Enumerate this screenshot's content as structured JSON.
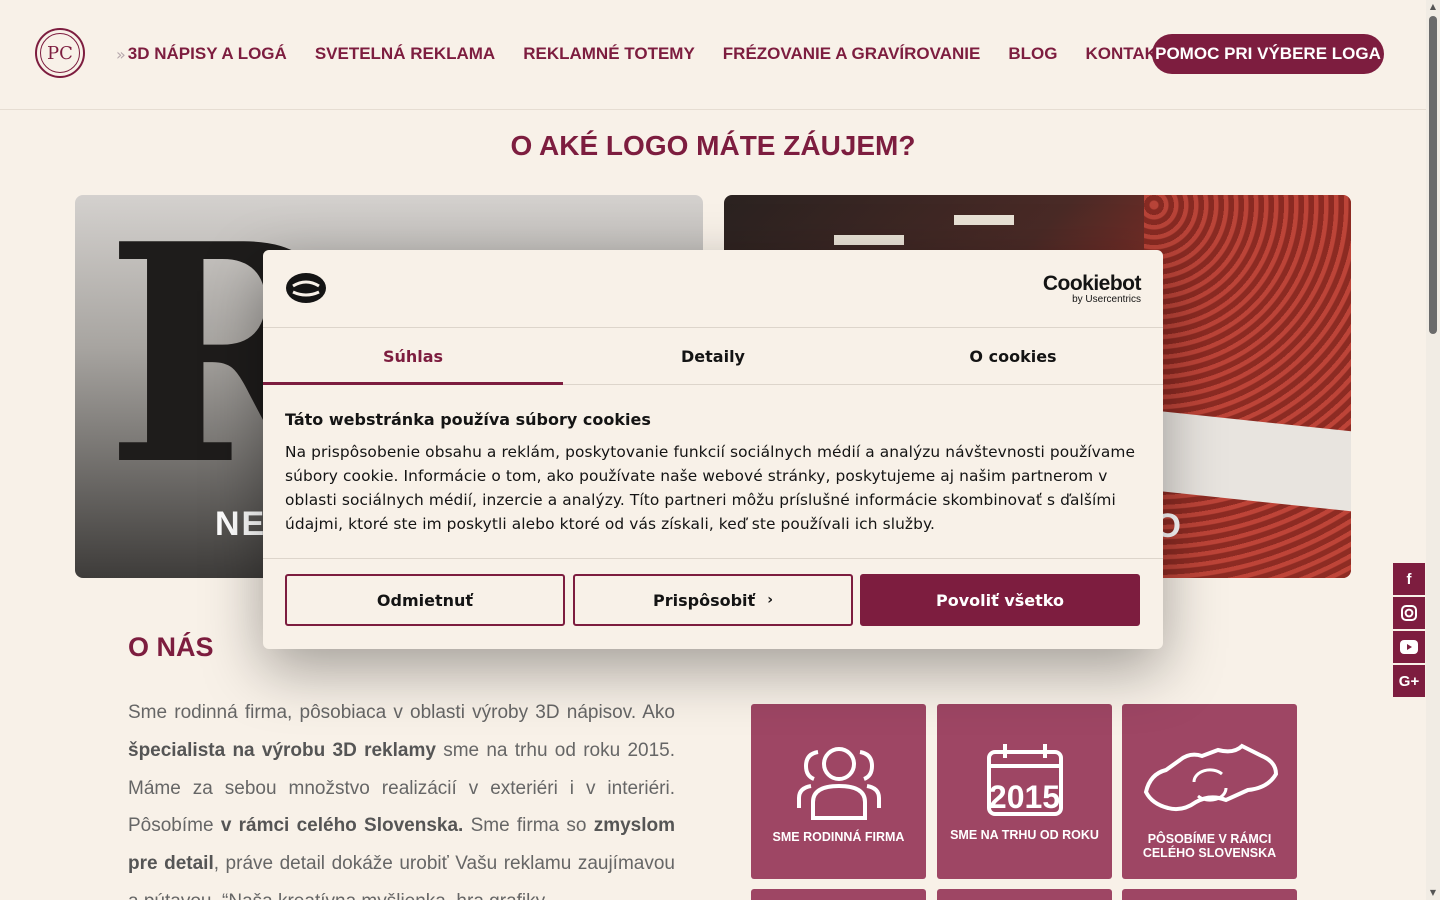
{
  "brand": {
    "logo_text": "PC"
  },
  "nav": {
    "items": [
      "3D NÁPISY A LOGÁ",
      "SVETELNÁ REKLAMA",
      "REKLAMNÉ TOTEMY",
      "FRÉZOVANIE A GRAVÍROVANIE",
      "BLOG",
      "KONTAKT"
    ],
    "cta": "POMOC PRI VÝBERE LOGA"
  },
  "hero": {
    "headline": "O AKÉ LOGO MÁTE ZÁUJEM?",
    "card_left_caption": "NE",
    "card_right_caption": "O"
  },
  "about": {
    "title": "O NÁS",
    "text_html_parts": [
      "Sme rodinná firma, pôsobiaca v oblasti výroby 3D nápisov. Ako ",
      "špecialista na výrobu 3D reklamy",
      " sme na trhu od roku 2015. Máme za sebou množstvo realizácií v exteriéri i v interiéri. Pôsobíme ",
      "v rámci celého Slovenska.",
      " Sme firma so ",
      "zmyslom pre detail",
      ", práve detail dokáže urobiť Vašu reklamu zaujímavou a pútavou. “Naša kreatívna myšlienka, hra grafiky,"
    ]
  },
  "tiles": [
    {
      "label": "SME RODINNÁ FIRMA",
      "icon": "family-icon"
    },
    {
      "label": "SME NA TRHU OD ROKU",
      "icon": "calendar-icon",
      "year": "2015"
    },
    {
      "label": "PÔSOBÍME V RÁMCI CELÉHO SLOVENSKA",
      "icon": "slovakia-map-icon"
    }
  ],
  "social": [
    "f",
    "ig",
    "yt",
    "G+"
  ],
  "cookie": {
    "brand_main": "Cookiebot",
    "brand_sub": "by Usercentrics",
    "tabs": [
      "Súhlas",
      "Detaily",
      "O cookies"
    ],
    "heading": "Táto webstránka používa súbory cookies",
    "body": "Na prispôsobenie obsahu a reklám, poskytovanie funkcií sociálnych médií a analýzu návštevnosti používame súbory cookie. Informácie o tom, ako používate naše webové stránky, poskytujeme aj našim partnerom v oblasti sociálnych médií, inzercie a analýzy. Títo partneri môžu príslušné informácie skombinovať s ďalšími údajmi, ktoré ste im poskytli alebo ktoré od vás získali, keď ste používali ich služby.",
    "btn_reject": "Odmietnuť",
    "btn_customize": "Prispôsobiť",
    "btn_accept": "Povoliť všetko"
  },
  "colors": {
    "accent": "#7d1d3f",
    "tile": "#9e4664",
    "background": "#f8f1e8"
  }
}
